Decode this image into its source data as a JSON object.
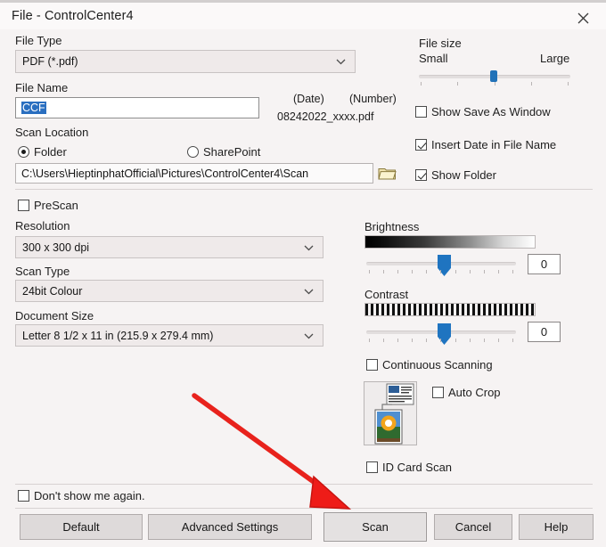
{
  "window": {
    "title": "File - ControlCenter4",
    "close_icon": "close-icon"
  },
  "left": {
    "file_type_label": "File Type",
    "file_type_value": "PDF (*.pdf)",
    "file_name_label": "File Name",
    "file_name_value": "CCF",
    "scan_location_label": "Scan Location",
    "radio_folder": "Folder",
    "radio_sharepoint": "SharePoint",
    "folder_path": "C:\\Users\\HieptinphatOfficial\\Pictures\\ControlCenter4\\Scan",
    "browse_icon": "folder-icon",
    "prescan_label": "PreScan",
    "resolution_label": "Resolution",
    "resolution_value": "300 x 300 dpi",
    "scan_type_label": "Scan Type",
    "scan_type_value": "24bit Colour",
    "document_size_label": "Document Size",
    "document_size_value": "Letter 8 1/2 x 11 in (215.9 x 279.4 mm)"
  },
  "filename_hint": {
    "date_label": "(Date)",
    "number_label": "(Number)",
    "example": "08242022_xxxx.pdf"
  },
  "right": {
    "file_size_label": "File size",
    "file_size_min": "Small",
    "file_size_max": "Large",
    "show_save_as_window": "Show Save As Window",
    "insert_date_in_file_name": "Insert Date in File Name",
    "show_folder": "Show Folder",
    "brightness_label": "Brightness",
    "brightness_value": "0",
    "contrast_label": "Contrast",
    "contrast_value": "0",
    "continuous_scanning": "Continuous Scanning",
    "auto_crop": "Auto Crop",
    "id_card_scan": "ID Card Scan",
    "preview_icon": "scan-preview-icon"
  },
  "checkboxes": {
    "show_save_as_window_checked": false,
    "insert_date_checked": true,
    "show_folder_checked": true,
    "prescan_checked": false,
    "continuous_scanning_checked": false,
    "auto_crop_checked": false,
    "id_card_scan_checked": false,
    "dont_show_again_checked": false,
    "folder_selected": true,
    "sharepoint_selected": false
  },
  "footer": {
    "dont_show_again": "Don't show me again.",
    "default_button": "Default",
    "advanced_settings_button": "Advanced Settings",
    "scan_button": "Scan",
    "cancel_button": "Cancel",
    "help_button": "Help"
  },
  "annotation": {
    "arrow_color": "#e8221c",
    "arrow_points_to": "Scan"
  },
  "colors": {
    "accent": "#1f74c0",
    "selection": "#2a6fc0",
    "dialog_bg": "#f6f3f3",
    "arrow_red": "#e8221c"
  }
}
